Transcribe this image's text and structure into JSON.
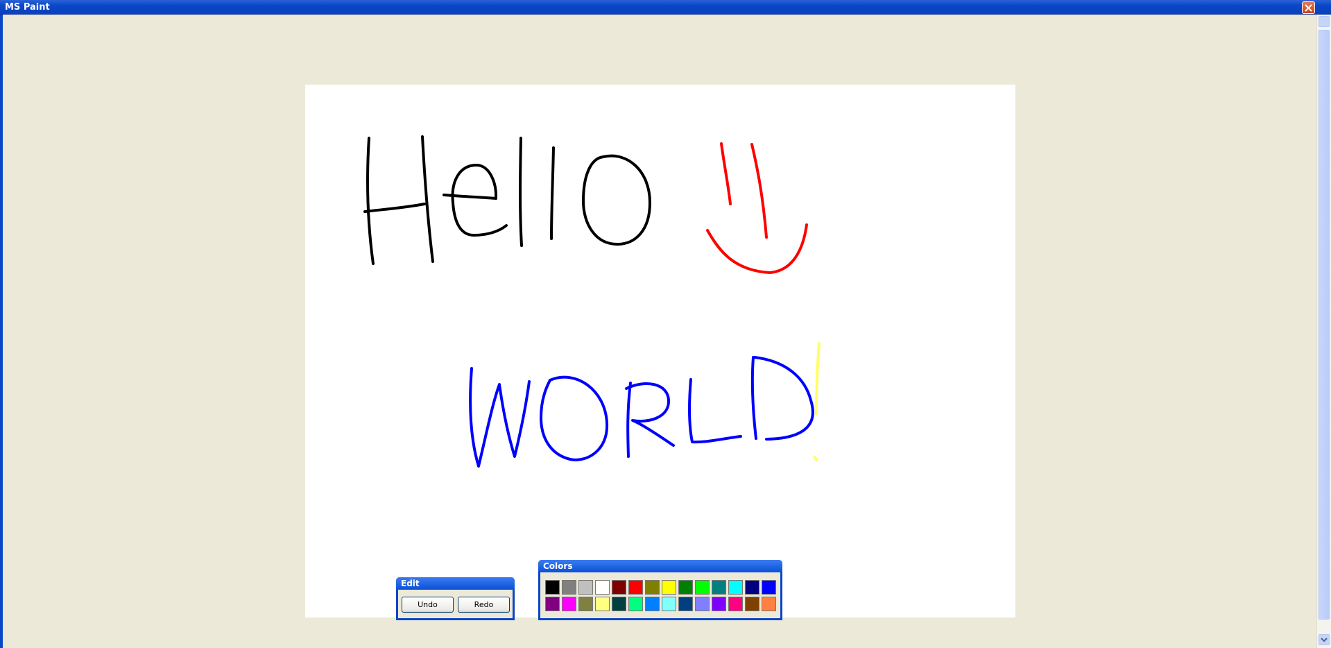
{
  "window": {
    "title": "MS Paint"
  },
  "edit_panel": {
    "title": "Edit",
    "undo_label": "Undo",
    "redo_label": "Redo"
  },
  "colors_panel": {
    "title": "Colors",
    "swatches": [
      "#000000",
      "#808080",
      "#c0c0c0",
      "#ffffff",
      "#800000",
      "#ff0000",
      "#808000",
      "#ffff00",
      "#008000",
      "#00ff00",
      "#008080",
      "#00ffff",
      "#000080",
      "#0000ff",
      "#800080",
      "#ff00ff",
      "#808040",
      "#ffff80",
      "#004040",
      "#00ff80",
      "#0080ff",
      "#80ffff",
      "#004080",
      "#8080ff",
      "#8000ff",
      "#ff0080",
      "#804000",
      "#ff8040"
    ]
  },
  "drawing": {
    "strokes": [
      {
        "name": "letter-h",
        "color": "#000000"
      },
      {
        "name": "letter-e",
        "color": "#000000"
      },
      {
        "name": "letter-l1",
        "color": "#000000"
      },
      {
        "name": "letter-l2",
        "color": "#000000"
      },
      {
        "name": "letter-o",
        "color": "#000000"
      },
      {
        "name": "smiley",
        "color": "#ff0000"
      },
      {
        "name": "letter-w",
        "color": "#0000ff"
      },
      {
        "name": "letter-o2",
        "color": "#0000ff"
      },
      {
        "name": "letter-r",
        "color": "#0000ff"
      },
      {
        "name": "letter-l3",
        "color": "#0000ff"
      },
      {
        "name": "letter-d",
        "color": "#0000ff"
      },
      {
        "name": "exclamation",
        "color": "#ffff66"
      }
    ]
  }
}
